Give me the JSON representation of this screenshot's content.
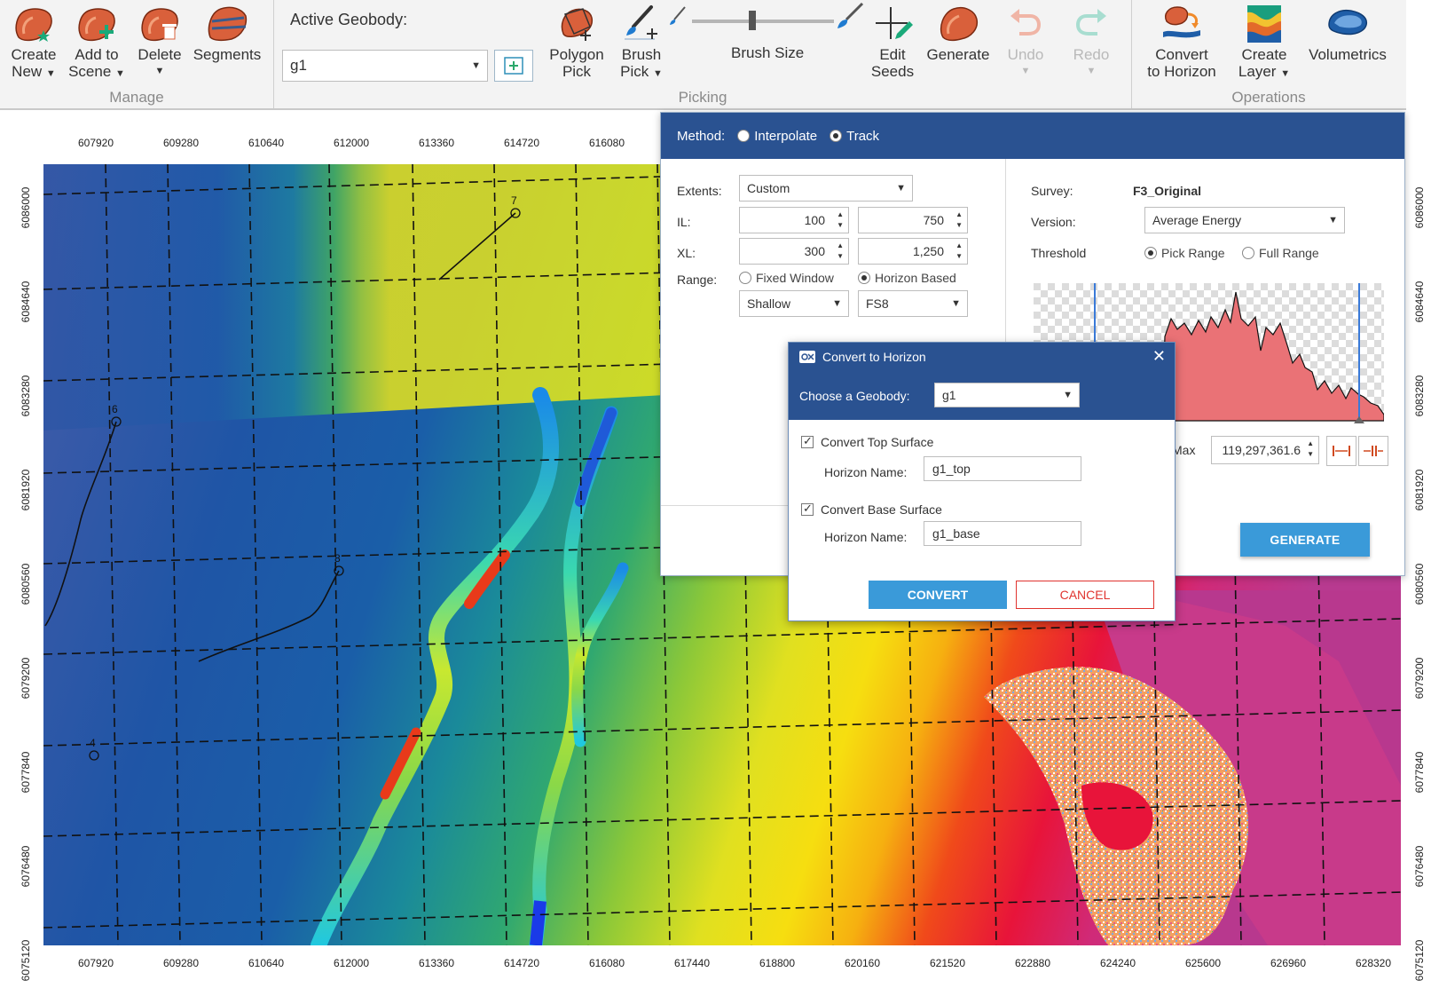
{
  "ribbon": {
    "manage": {
      "group_label": "Manage",
      "create_new": {
        "line1": "Create",
        "line2": "New",
        "icon": "create-geobody-icon"
      },
      "add_to_scene": {
        "line1": "Add to",
        "line2": "Scene",
        "icon": "add-geobody-icon"
      },
      "delete": {
        "line1": "Delete",
        "icon": "delete-geobody-icon"
      },
      "segments": {
        "line1": "Segments",
        "icon": "segments-icon"
      }
    },
    "picking": {
      "group_label": "Picking",
      "active_geobody_label": "Active Geobody:",
      "active_geobody_value": "g1",
      "polygon_pick": {
        "line1": "Polygon",
        "line2": "Pick"
      },
      "brush_pick": {
        "line1": "Brush",
        "line2": "Pick"
      },
      "brush_size_label": "Brush Size",
      "edit_seeds": {
        "line1": "Edit",
        "line2": "Seeds"
      },
      "generate": {
        "line1": "Generate"
      },
      "undo": {
        "line1": "Undo"
      },
      "redo": {
        "line1": "Redo"
      }
    },
    "operations": {
      "group_label": "Operations",
      "convert_to_horizon": {
        "line1": "Convert",
        "line2": "to Horizon"
      },
      "create_layer": {
        "line1": "Create",
        "line2": "Layer"
      },
      "volumetrics": {
        "line1": "Volumetrics"
      }
    }
  },
  "map": {
    "x_ticks": [
      "607920",
      "609280",
      "610640",
      "612000",
      "613360",
      "614720",
      "616080",
      "617440",
      "618800",
      "620160",
      "621520",
      "622880",
      "624240",
      "625600",
      "626960",
      "628320"
    ],
    "x_ticks_top": [
      "607920",
      "609280",
      "610640",
      "612000",
      "613360",
      "614720",
      "616080"
    ],
    "y_ticks": [
      "6086000",
      "6084640",
      "6083280",
      "6081920",
      "6080560",
      "6079200",
      "6077840",
      "6076480",
      "6075120"
    ],
    "wells": [
      "7",
      "6",
      "8",
      "4"
    ]
  },
  "panel": {
    "method_label": "Method:",
    "method_options": [
      "Interpolate",
      "Track"
    ],
    "extents_label": "Extents:",
    "extents_value": "Custom",
    "il_label": "IL:",
    "il_min": "100",
    "il_max": "750",
    "xl_label": "XL:",
    "xl_min": "300",
    "xl_max": "1,250",
    "range_label": "Range:",
    "range_options": [
      "Fixed Window",
      "Horizon Based"
    ],
    "range_depth": "Shallow",
    "range_horizon": "FS8",
    "survey_label": "Survey:",
    "survey_value": "F3_Original",
    "version_label": "Version:",
    "version_value": "Average Energy",
    "threshold_label": "Threshold",
    "threshold_options": [
      "Pick Range",
      "Full Range"
    ],
    "max_label": "Max",
    "max_value": "119,297,361.6",
    "generate_label": "GENERATE"
  },
  "dialog": {
    "title": "Convert to Horizon",
    "choose_label": "Choose a Geobody:",
    "choose_value": "g1",
    "top_surface_label": "Convert Top Surface",
    "top_name_label": "Horizon Name:",
    "top_name_value": "g1_top",
    "base_surface_label": "Convert Base Surface",
    "base_name_label": "Horizon Name:",
    "base_name_value": "g1_base",
    "convert_label": "CONVERT",
    "cancel_label": "CANCEL"
  }
}
